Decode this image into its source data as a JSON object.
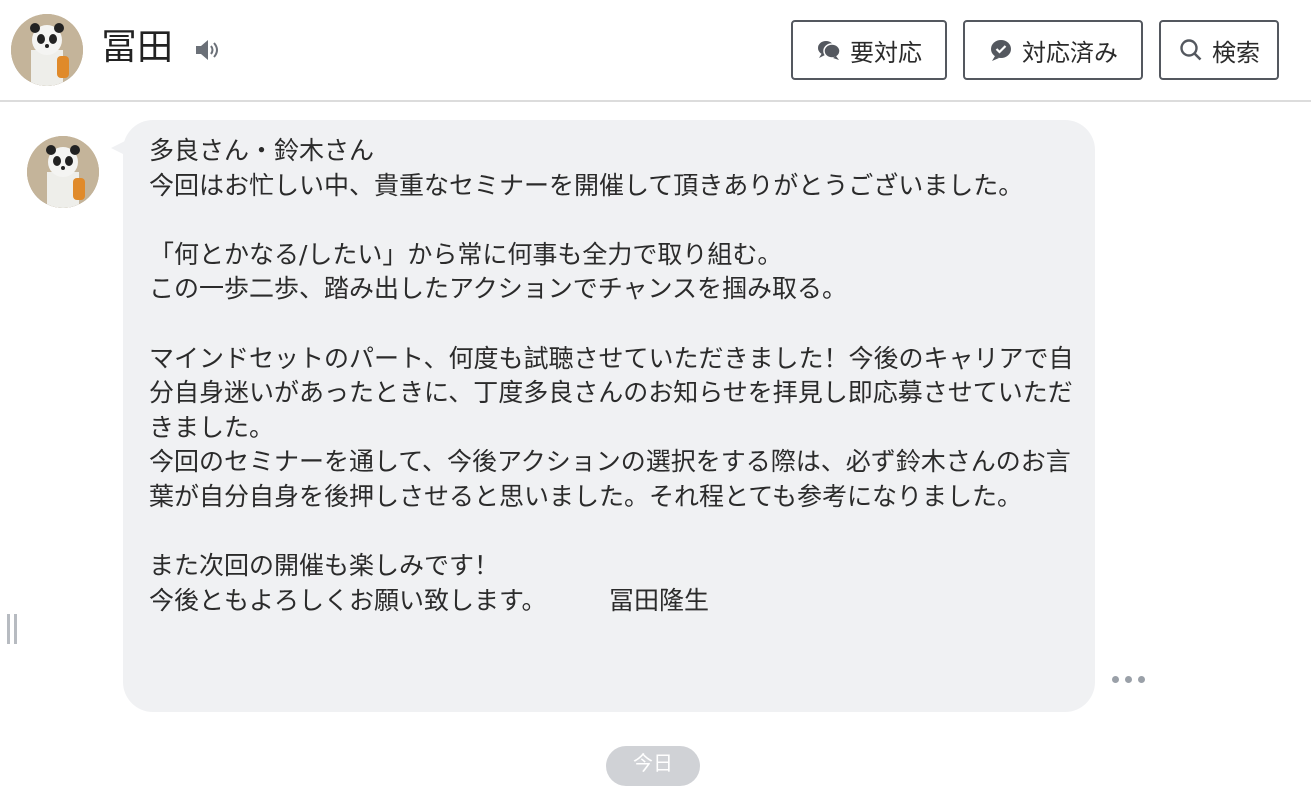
{
  "header": {
    "name": "冨田",
    "buttons": {
      "need_response": "要対応",
      "responded": "対応済み",
      "search": "検索"
    }
  },
  "message": {
    "text": "多良さん・鈴木さん\n今回はお忙しい中、貴重なセミナーを開催して頂きありがとうございました。\n\n「何とかなる/したい」から常に何事も全力で取り組む。\nこの一歩二歩、踏み出したアクションでチャンスを掴み取る。\n\nマインドセットのパート、何度も試聴させていただきました！今後のキャリアで自分自身迷いがあったときに、丁度多良さんのお知らせを拝見し即応募させていただきました。\n今回のセミナーを通して、今後アクションの選択をする際は、必ず鈴木さんのお言葉が自分自身を後押しさせると思いました。それ程とても参考になりました。\n\nまた次回の開催も楽しみです！\n今後ともよろしくお願い致します。　　　冨田隆生"
  },
  "date_divider": "今日",
  "icons": {
    "speaker": "speaker-icon",
    "need_response": "chat-bubbles-icon",
    "responded": "chat-check-icon",
    "search": "search-icon",
    "more": "more-icon",
    "handle": "resize-handle-icon"
  }
}
